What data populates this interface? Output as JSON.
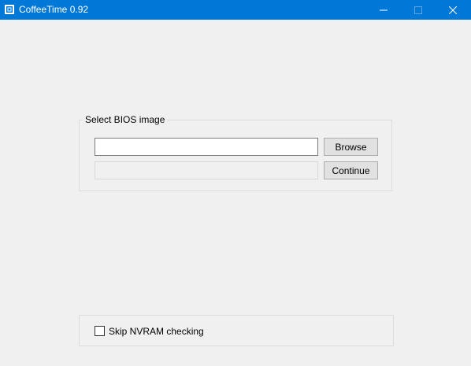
{
  "window": {
    "title": "CoffeeTime 0.92",
    "title_bar_color": "#0078d7",
    "icons": {
      "app": "app-icon",
      "minimize": "minimize-icon",
      "maximize": "maximize-icon",
      "close": "close-icon"
    }
  },
  "bios_group": {
    "legend": "Select BIOS image",
    "path_input": {
      "value": "",
      "placeholder": ""
    },
    "status_field": "",
    "browse_label": "Browse",
    "continue_label": "Continue"
  },
  "options": {
    "skip_nvram_label": "Skip NVRAM checking",
    "skip_nvram_checked": false
  }
}
